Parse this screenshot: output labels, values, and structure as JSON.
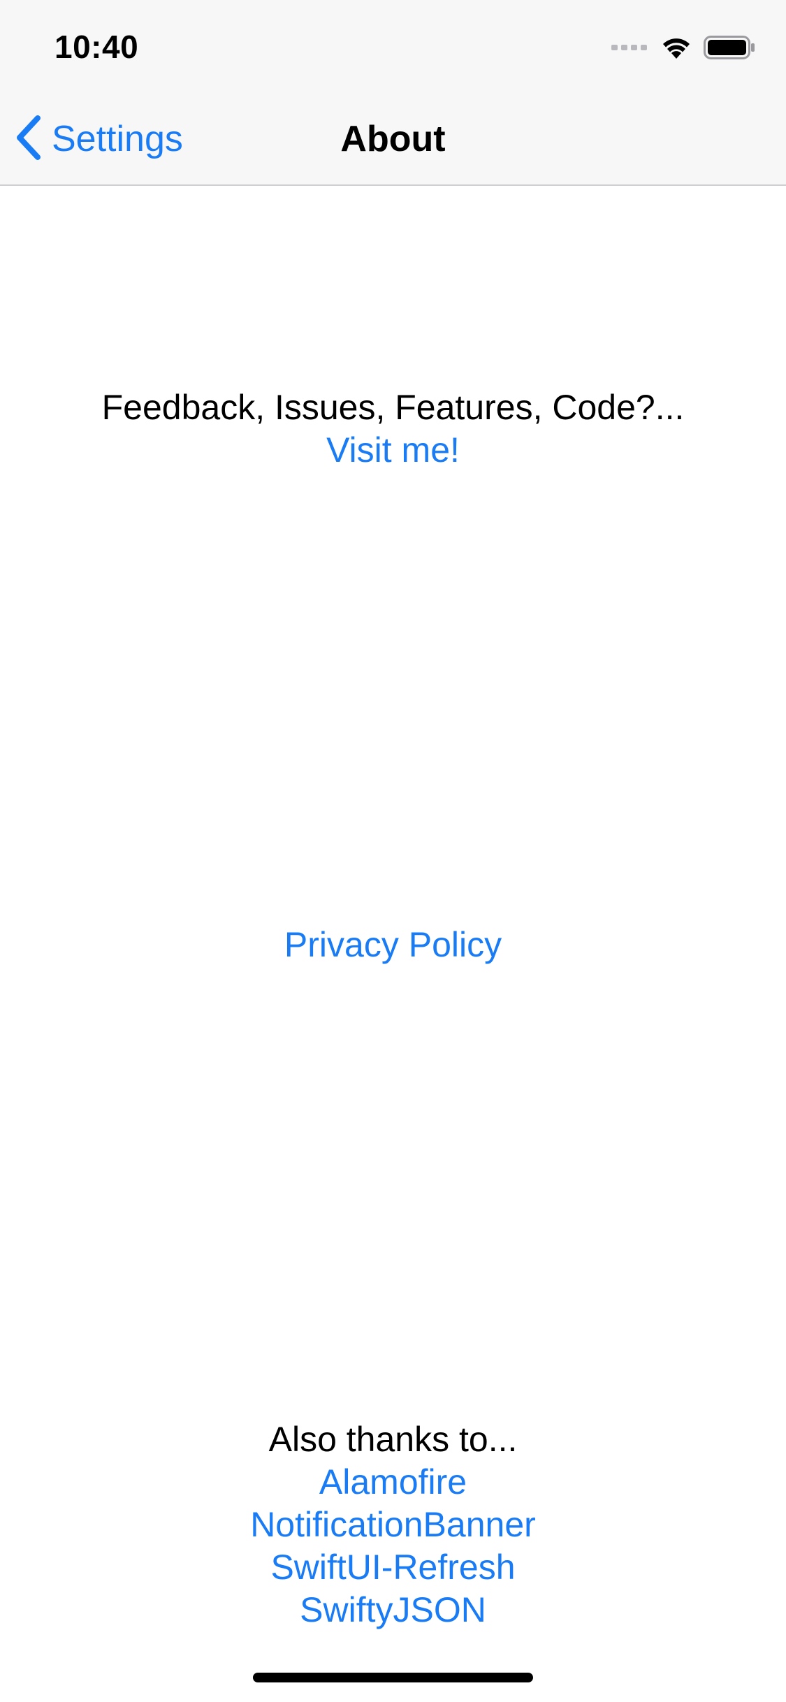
{
  "status_bar": {
    "time": "10:40",
    "icons": [
      "signal-icon",
      "wifi-icon",
      "battery-icon"
    ]
  },
  "nav": {
    "back_label": "Settings",
    "title": "About",
    "back_icon": "chevron-left-icon"
  },
  "feedback": {
    "prompt": "Feedback, Issues, Features, Code?...",
    "link": "Visit me!"
  },
  "privacy": {
    "link": "Privacy Policy"
  },
  "thanks": {
    "heading": "Also thanks to...",
    "items": [
      "Alamofire",
      "NotificationBanner",
      "SwiftUI-Refresh",
      "SwiftyJSON"
    ]
  },
  "colors": {
    "accent": "#1a7cf5",
    "nav_background": "#f7f7f8",
    "text": "#000000"
  }
}
